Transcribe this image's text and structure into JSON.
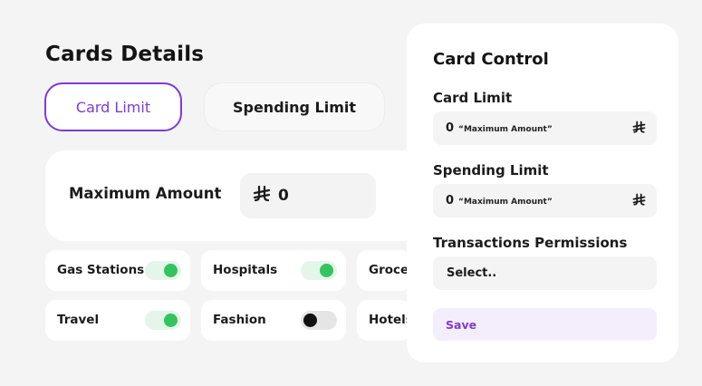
{
  "page": {
    "title": "Cards Details"
  },
  "tabs": [
    {
      "label": "Card Limit",
      "active": true
    },
    {
      "label": "Spending Limit",
      "active": false
    }
  ],
  "amount": {
    "label": "Maximum Amount",
    "value": "0",
    "currency_icon": "currency-icon"
  },
  "categories": [
    {
      "label": "Gas Stations",
      "enabled": true
    },
    {
      "label": "Hospitals",
      "enabled": true
    },
    {
      "label": "Groce",
      "enabled": null
    },
    {
      "label": "Travel",
      "enabled": true
    },
    {
      "label": "Fashion",
      "enabled": false
    },
    {
      "label": "Hotels",
      "enabled": null
    }
  ],
  "panel": {
    "title": "Card Control",
    "card_limit": {
      "label": "Card Limit",
      "value": "0",
      "placeholder": "“Maximum Amount”"
    },
    "spending_limit": {
      "label": "Spending Limit",
      "value": "0",
      "placeholder": "“Maximum Amount”"
    },
    "permissions": {
      "label": "Transactions Permissions",
      "selected": "Select.."
    },
    "save_label": "Save"
  },
  "colors": {
    "accent": "#7d3ad6",
    "toggle_on": "#34c35f",
    "background": "#f4f4f4"
  }
}
